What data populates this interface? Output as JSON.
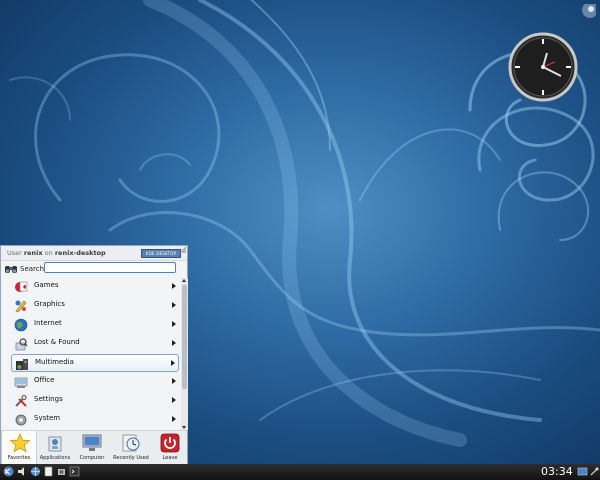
{
  "launcher": {
    "user_prefix": "User",
    "user_name": "renix",
    "on_word": "on",
    "host": "renix-desktop",
    "search_label": "Search:",
    "search_value": "",
    "items": [
      {
        "label": "Games",
        "icon": "games-icon"
      },
      {
        "label": "Graphics",
        "icon": "graphics-icon"
      },
      {
        "label": "Internet",
        "icon": "internet-icon"
      },
      {
        "label": "Lost & Found",
        "icon": "lost-found-icon"
      },
      {
        "label": "Multimedia",
        "icon": "multimedia-icon"
      },
      {
        "label": "Office",
        "icon": "office-icon"
      },
      {
        "label": "Settings",
        "icon": "settings-icon"
      },
      {
        "label": "System",
        "icon": "system-icon"
      }
    ],
    "selected_item": "Multimedia",
    "tabs": [
      {
        "label": "Favorites",
        "icon": "star-icon"
      },
      {
        "label": "Applications",
        "icon": "applications-icon"
      },
      {
        "label": "Computer",
        "icon": "computer-icon"
      },
      {
        "label": "Recently Used",
        "icon": "clock-icon"
      },
      {
        "label": "Leave",
        "icon": "power-icon"
      }
    ],
    "selected_tab": "Favorites"
  },
  "taskbar": {
    "clock": "03:34",
    "icons": [
      "kde-menu-icon",
      "volume-icon",
      "network-icon",
      "files-icon",
      "clipboard-icon",
      "terminal-icon",
      "show-desktop-icon"
    ]
  },
  "colors": {
    "desktop": "#2e6aa3",
    "accent": "#4b83c7",
    "taskbar": "#1a1a1a",
    "leave": "#c8222a"
  }
}
